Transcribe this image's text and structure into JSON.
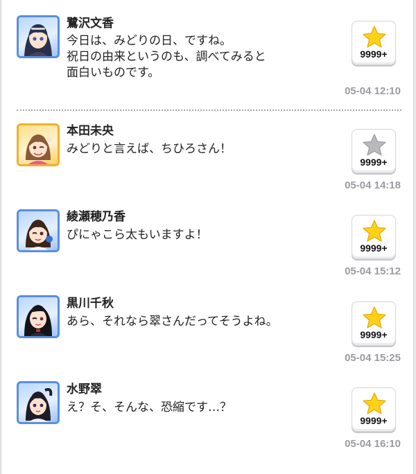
{
  "posts": [
    {
      "name": "鷺沢文香",
      "lines": [
        "今日は、みどりの日、ですね。",
        "祝日の由来というのも、調べてみると",
        "面白いものです。"
      ],
      "like_count": "9999+",
      "liked": true,
      "time": "05-04 12:10",
      "avatar_type": "cool"
    },
    {
      "name": "本田未央",
      "lines": [
        "みどりと言えば、ちひろさん！"
      ],
      "like_count": "9999+",
      "liked": false,
      "time": "05-04 14:18",
      "avatar_type": "passion"
    },
    {
      "name": "綾瀬穂乃香",
      "lines": [
        "ぴにゃこら太もいますよ！"
      ],
      "like_count": "9999+",
      "liked": true,
      "time": "05-04 15:12",
      "avatar_type": "cool"
    },
    {
      "name": "黒川千秋",
      "lines": [
        "あら、それなら翠さんだってそうよね。"
      ],
      "like_count": "9999+",
      "liked": true,
      "time": "05-04 15:25",
      "avatar_type": "cool"
    },
    {
      "name": "水野翠",
      "lines": [
        "え？そ、そんな、恐縮です…？"
      ],
      "like_count": "9999+",
      "liked": true,
      "time": "05-04 16:10",
      "avatar_type": "cool"
    }
  ],
  "colors": {
    "star_active": "#ffd21a",
    "star_inactive": "#b9b9bd",
    "timestamp": "#9b9ba3",
    "cool_frame": "#5a8fe0",
    "passion_frame": "#f0b02a"
  }
}
